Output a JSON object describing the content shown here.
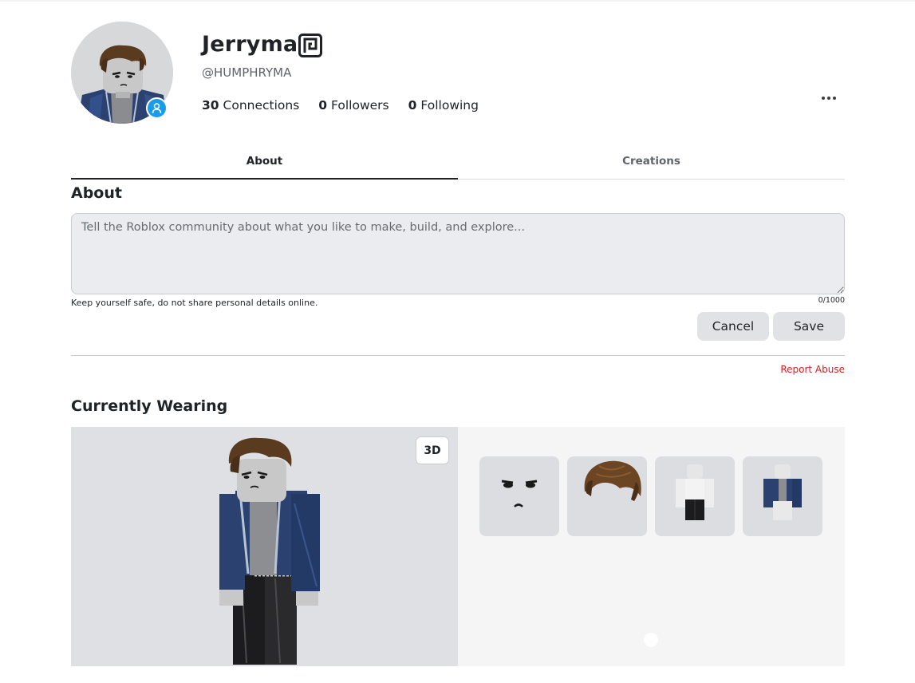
{
  "profile": {
    "display_name": "Jerryma",
    "username": "@HUMPHRYMA",
    "stats": [
      {
        "count": "30",
        "label": "Connections"
      },
      {
        "count": "0",
        "label": "Followers"
      },
      {
        "count": "0",
        "label": "Following"
      }
    ]
  },
  "tabs": [
    "About",
    "Creations"
  ],
  "about": {
    "title": "About",
    "placeholder": "Tell the Roblox community about what you like to make, build, and explore...",
    "value": "",
    "safety_note": "Keep yourself safe, do not share personal details online.",
    "char_count": "0/1000",
    "cancel_label": "Cancel",
    "save_label": "Save",
    "report_label": "Report Abuse"
  },
  "wearing": {
    "title": "Currently Wearing",
    "view_toggle_label": "3D",
    "items": [
      "face",
      "hair",
      "pants",
      "jacket"
    ]
  },
  "colors": {
    "presence": "#1a9be8",
    "report": "#d21f1f",
    "jacket": "#243a66"
  },
  "icons": [
    "verified-badge-icon",
    "presence-user-icon",
    "more-options-icon"
  ]
}
